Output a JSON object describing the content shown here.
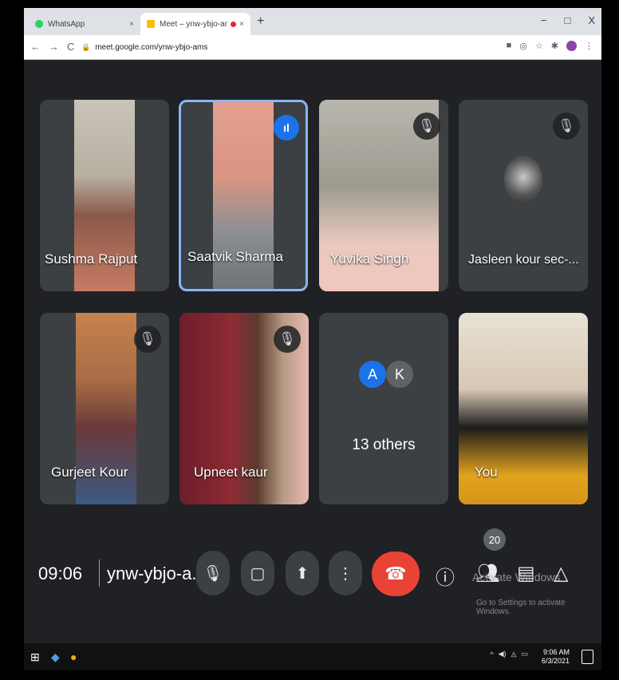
{
  "browser": {
    "tabs": [
      {
        "title": "WhatsApp",
        "close": "×"
      },
      {
        "title": "Meet – ynw-ybjo-ams",
        "close": "×"
      }
    ],
    "new_tab": "+",
    "window_controls": [
      "−",
      "□",
      "X"
    ],
    "url": "meet.google.com/ynw-ybjo-ams",
    "nav": [
      "←",
      "→",
      "C"
    ]
  },
  "participants": [
    {
      "name": "Sushma Rajput",
      "muted": false,
      "speaking": false
    },
    {
      "name": "Saatvik Sharma",
      "muted": false,
      "speaking": true
    },
    {
      "name": "Yuvika Singh",
      "muted": true,
      "speaking": false
    },
    {
      "name": "Jasleen kour sec-...",
      "muted": true,
      "speaking": false
    },
    {
      "name": "Gurjeet Kour",
      "muted": true,
      "speaking": false
    },
    {
      "name": "Upneet kaur",
      "muted": true,
      "speaking": false
    },
    {
      "name": "13 others",
      "avatars": [
        "A",
        "K"
      ],
      "avatar_colors": [
        "#1a73e8",
        "#5f6368"
      ]
    },
    {
      "name": "You",
      "muted": false,
      "speaking": false
    }
  ],
  "bottom_bar": {
    "time": "09:06",
    "meeting_code": "ynw-ybjo-a...",
    "participant_count": "20",
    "activate_title": "Activate Windows",
    "activate_sub": "Go to Settings to activate Windows."
  },
  "taskbar": {
    "clock_time": "9:06 AM",
    "clock_date": "6/3/2021"
  },
  "colors": {
    "background": "#202124",
    "tile": "#3c4043",
    "leave_button": "#ea4335",
    "speaking_accent": "#1a73e8"
  }
}
